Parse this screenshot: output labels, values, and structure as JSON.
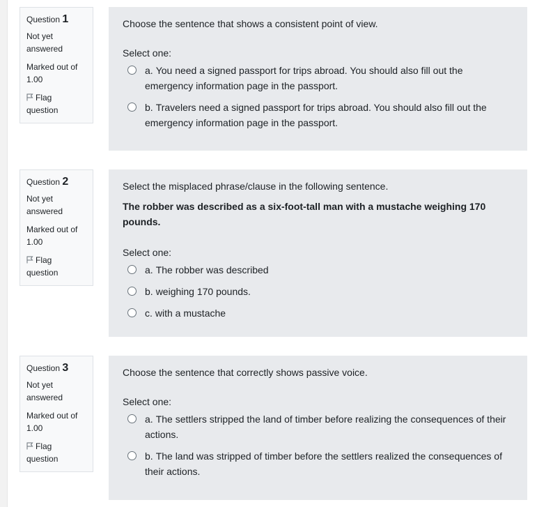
{
  "labels": {
    "question": "Question",
    "select_one": "Select one:",
    "flag": "Flag",
    "flag_line2": "question",
    "state_line1": "Not yet",
    "state_line2": "answered",
    "marked_line1": "Marked out of",
    "marked_line2": "1.00"
  },
  "questions": [
    {
      "number": "1",
      "text": "Choose the sentence that shows a consistent point of view.",
      "bold_text": "",
      "options": [
        {
          "letter": "a.",
          "text": "You need a signed passport for trips abroad. You should also fill out the emergency information page in the passport."
        },
        {
          "letter": "b.",
          "text": "Travelers need a signed passport for trips abroad. You should also fill out the emergency information page in the passport."
        }
      ]
    },
    {
      "number": "2",
      "text": "Select the misplaced phrase/clause in the following sentence.",
      "bold_text": "The robber was described as a six-foot-tall man with a mustache weighing 170 pounds.",
      "options": [
        {
          "letter": "a.",
          "text": "The robber was described"
        },
        {
          "letter": "b.",
          "text": "weighing 170 pounds."
        },
        {
          "letter": "c.",
          "text": "with a mustache"
        }
      ]
    },
    {
      "number": "3",
      "text": "Choose the sentence that correctly shows passive voice.",
      "bold_text": "",
      "options": [
        {
          "letter": "a.",
          "text": "The settlers stripped the land of timber before realizing the consequences of their actions."
        },
        {
          "letter": "b.",
          "text": "The land was stripped of timber before the settlers realized the consequences of their actions."
        }
      ]
    }
  ],
  "colors": {
    "content_bg": "#e8eaed",
    "info_bg": "#f8f9fa",
    "border": "#dee2e6"
  }
}
